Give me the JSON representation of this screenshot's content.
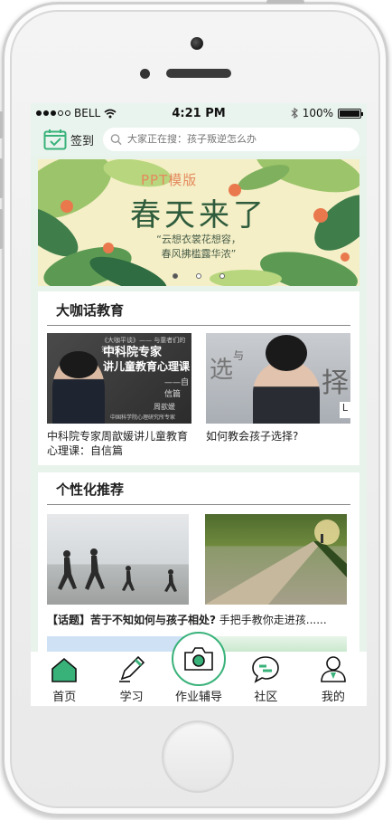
{
  "status": {
    "carrier": "BELL",
    "time": "4:21 PM",
    "battery": "100%",
    "battery_level": 1.0
  },
  "header": {
    "checkin_label": "签到",
    "search_placeholder": "大家正在搜：孩子叛逆怎么办"
  },
  "banner": {
    "tag": "PPT模版",
    "title": "春天来了",
    "line1": "“云想衣裳花想容，",
    "line2": "春风拂槛露华浓”",
    "pages": 3,
    "active_page": 0
  },
  "section_talk": {
    "title": "大咖话教育",
    "videos": [
      {
        "overlay_small": "《大咖平谈》—— 与童者们的第四场",
        "overlay_line1": "中科院专家",
        "overlay_line2": "讲儿童教育心理课",
        "overlay_line3": "——自信篇",
        "overlay_name": "周歆媛",
        "overlay_org": "中国科学院心理研究所专家",
        "caption": "中科院专家周歆媛讲儿童教育心理课：自信篇"
      },
      {
        "overlay_word1": "选",
        "overlay_word2": "与",
        "overlay_word3": "择",
        "overlay_badge": "L",
        "caption": "如何教会孩子选择?"
      }
    ]
  },
  "section_recommend": {
    "title": "个性化推荐",
    "article_bold": "【话题】苦于不知如何与孩子相处?",
    "article_rest": " 手把手教你走进孩......"
  },
  "tabs": [
    {
      "label": "首页",
      "icon": "home-icon",
      "active": true
    },
    {
      "label": "学习",
      "icon": "pen-icon",
      "active": false
    },
    {
      "label": "作业辅导",
      "icon": "camera-icon",
      "active": false
    },
    {
      "label": "社区",
      "icon": "chat-icon",
      "active": false
    },
    {
      "label": "我的",
      "icon": "person-icon",
      "active": false
    }
  ],
  "colors": {
    "accent": "#39b27a",
    "screen_bg": "#e8f3ec"
  }
}
